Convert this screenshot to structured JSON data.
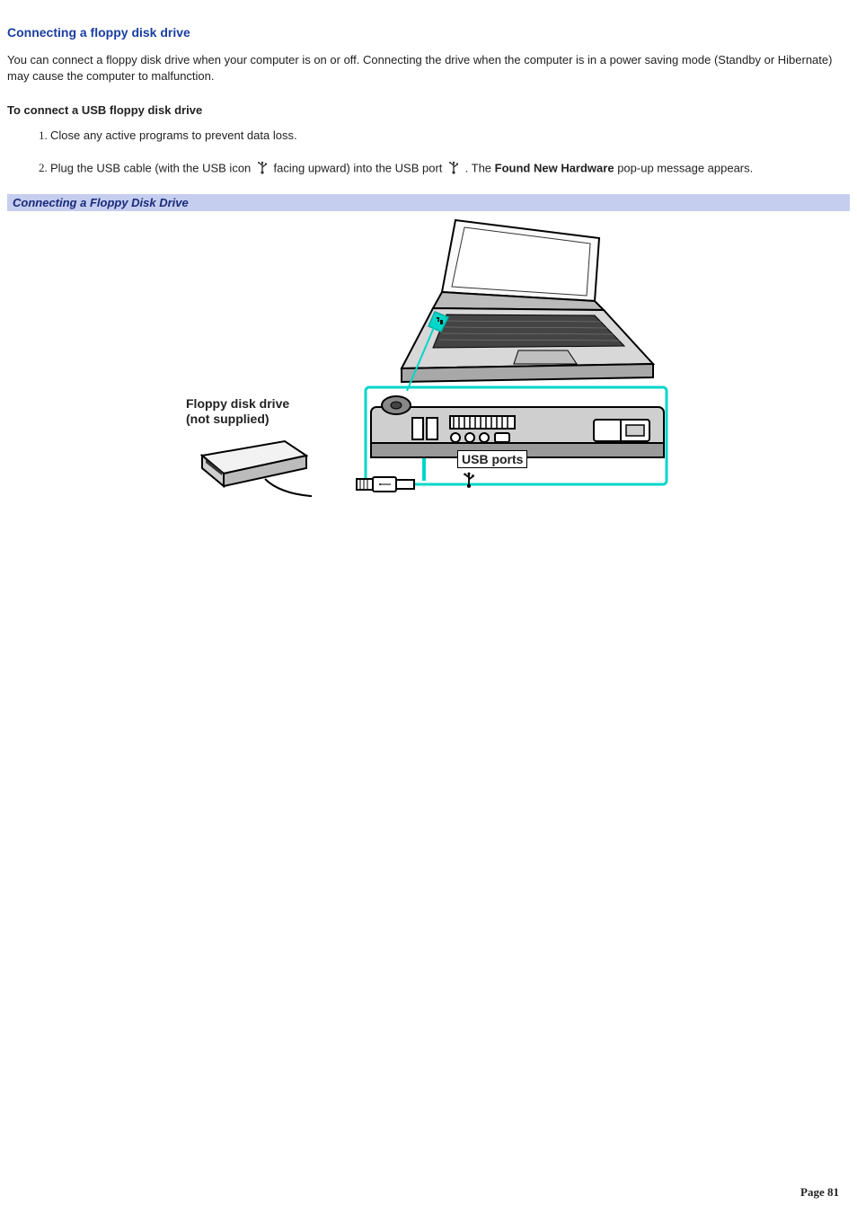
{
  "section": {
    "title": "Connecting a floppy disk drive",
    "intro": "You can connect a floppy disk drive when your computer is on or off. Connecting the drive when the computer is in a power saving mode (Standby or Hibernate) may cause the computer to malfunction.",
    "sub_title": "To connect a USB floppy disk drive"
  },
  "steps": {
    "item1": "Close any active programs to prevent data loss.",
    "item2_a": "Plug the USB cable (with the USB icon ",
    "item2_b": " facing upward) into the USB port ",
    "item2_c": " . The ",
    "item2_bold": "Found New Hardware",
    "item2_d": " pop-up message appears."
  },
  "figure": {
    "caption": "Connecting a Floppy Disk Drive",
    "fdd_label_line1": "Floppy disk drive",
    "fdd_label_line2": "(not supplied)",
    "usb_ports_label": "USB ports"
  },
  "footer": {
    "page_label": "Page 81"
  }
}
